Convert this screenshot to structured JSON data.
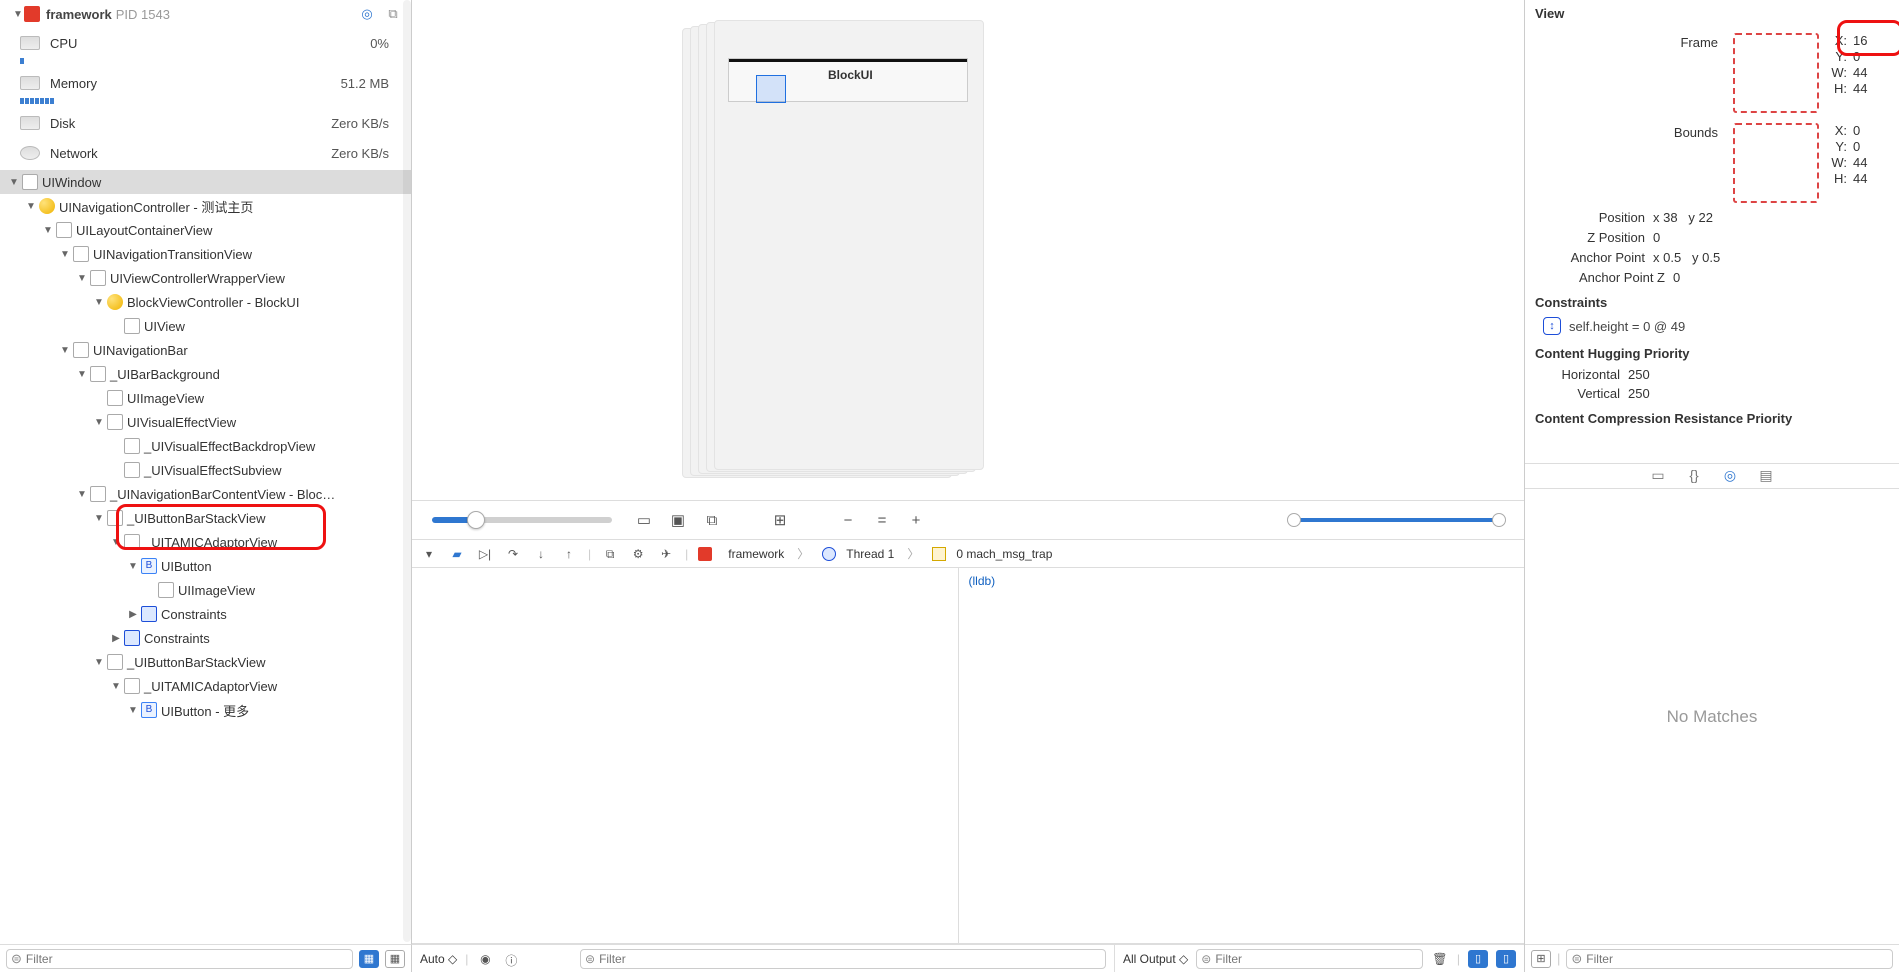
{
  "header": {
    "app": "framework",
    "pid_label": "PID 1543"
  },
  "metrics": {
    "cpu": {
      "name": "CPU",
      "value": "0%"
    },
    "memory": {
      "name": "Memory",
      "value": "51.2 MB"
    },
    "disk": {
      "name": "Disk",
      "value": "Zero KB/s"
    },
    "network": {
      "name": "Network",
      "value": "Zero KB/s"
    }
  },
  "tree": [
    {
      "indent": 0,
      "disc": "▼",
      "icon": "plain",
      "label": "UIWindow",
      "sel": true
    },
    {
      "indent": 1,
      "disc": "▼",
      "icon": "yellow-circ",
      "label": "UINavigationController - 测试主页"
    },
    {
      "indent": 2,
      "disc": "▼",
      "icon": "plain",
      "label": "UILayoutContainerView"
    },
    {
      "indent": 3,
      "disc": "▼",
      "icon": "plain",
      "label": "UINavigationTransitionView"
    },
    {
      "indent": 4,
      "disc": "▼",
      "icon": "plain",
      "label": "UIViewControllerWrapperView"
    },
    {
      "indent": 5,
      "disc": "▼",
      "icon": "yellow-circ",
      "label": "BlockViewController - BlockUI"
    },
    {
      "indent": 6,
      "disc": "",
      "icon": "plain",
      "label": "UIView"
    },
    {
      "indent": 3,
      "disc": "▼",
      "icon": "plain",
      "label": "UINavigationBar"
    },
    {
      "indent": 4,
      "disc": "▼",
      "icon": "plain",
      "label": "_UIBarBackground"
    },
    {
      "indent": 5,
      "disc": "",
      "icon": "plain",
      "label": "UIImageView"
    },
    {
      "indent": 5,
      "disc": "▼",
      "icon": "plain",
      "label": "UIVisualEffectView"
    },
    {
      "indent": 6,
      "disc": "",
      "icon": "plain",
      "label": "_UIVisualEffectBackdropView"
    },
    {
      "indent": 6,
      "disc": "",
      "icon": "plain",
      "label": "_UIVisualEffectSubview"
    },
    {
      "indent": 4,
      "disc": "▼",
      "icon": "plain",
      "label": "_UINavigationBarContentView - Bloc…"
    },
    {
      "indent": 5,
      "disc": "▼",
      "icon": "plain",
      "label": "_UIButtonBarStackView"
    },
    {
      "indent": 6,
      "disc": "▼",
      "icon": "plain",
      "label": "_UITAMICAdaptorView"
    },
    {
      "indent": 7,
      "disc": "▼",
      "icon": "btn-b",
      "btn": "B",
      "label": "UIButton"
    },
    {
      "indent": 8,
      "disc": "",
      "icon": "plain",
      "label": "UIImageView"
    },
    {
      "indent": 7,
      "disc": "▶",
      "icon": "con-b",
      "label": "Constraints"
    },
    {
      "indent": 6,
      "disc": "▶",
      "icon": "con-b",
      "label": "Constraints"
    },
    {
      "indent": 5,
      "disc": "▼",
      "icon": "plain",
      "label": "_UIButtonBarStackView"
    },
    {
      "indent": 6,
      "disc": "▼",
      "icon": "plain",
      "label": "_UITAMICAdaptorView"
    },
    {
      "indent": 7,
      "disc": "▼",
      "icon": "btn-b",
      "btn": "B",
      "label": "UIButton - 更多"
    }
  ],
  "canvas": {
    "nav_label": "UINavigationController",
    "block_label": "BlockUI"
  },
  "debug_bc": {
    "app": "framework",
    "thread": "Thread 1",
    "frame": "0 mach_msg_trap"
  },
  "lldb": "(lldb)",
  "bottom": {
    "left_filter": "Filter",
    "auto": "Auto",
    "var_filter": "Filter",
    "out_scope": "All Output",
    "out_filter": "Filter",
    "right_filter": "Filter"
  },
  "inspector": {
    "title": "View",
    "frame_label": "Frame",
    "frame": {
      "x": "16",
      "y": "0",
      "w": "44",
      "h": "44"
    },
    "bounds_label": "Bounds",
    "bounds": {
      "x": "0",
      "y": "0",
      "w": "44",
      "h": "44"
    },
    "position_label": "Position",
    "position": {
      "x": "38",
      "y": "22"
    },
    "zpos_label": "Z Position",
    "zpos": "0",
    "anchor_label": "Anchor Point",
    "anchor": {
      "x": "0.5",
      "y": "0.5"
    },
    "anchorz_label": "Anchor Point Z",
    "anchorz": "0",
    "constraints_label": "Constraints",
    "constraint1": "self.height = 0 @ 49",
    "hug_label": "Content Hugging Priority",
    "hug_h_l": "Horizontal",
    "hug_h": "250",
    "hug_v_l": "Vertical",
    "hug_v": "250",
    "comp_label": "Content Compression Resistance Priority",
    "nomatch": "No Matches"
  }
}
